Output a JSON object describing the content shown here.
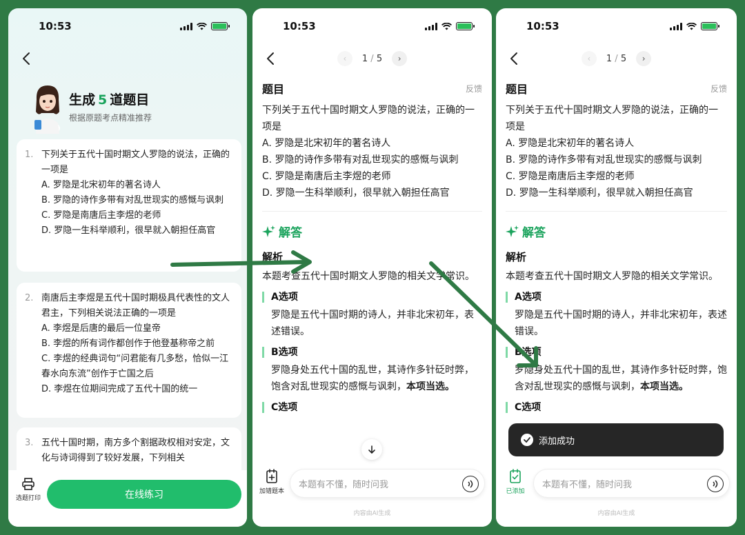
{
  "status": {
    "time": "10:53"
  },
  "screen1": {
    "title_prefix": "生成",
    "title_count": "5",
    "title_suffix": "道题目",
    "subtitle": "根据原题考点精准推荐",
    "questions": [
      {
        "num": "1.",
        "lines": [
          "下列关于五代十国时期文人罗隐的说法，正确的一项是",
          "A. 罗隐是北宋初年的著名诗人",
          "B. 罗隐的诗作多带有对乱世现实的感慨与讽刺",
          "C. 罗隐是南唐后主李煜的老师",
          "D. 罗隐一生科举顺利，很早就入朝担任高官"
        ]
      },
      {
        "num": "2.",
        "lines": [
          "南唐后主李煜是五代十国时期极具代表性的文人君主，下列相关说法正确的一项是",
          "A. 李煜是后唐的最后一位皇帝",
          "B. 李煜的所有词作都创作于他登基称帝之前",
          "C. 李煜的经典词句“问君能有几多愁，恰似一江春水向东流”创作于亡国之后",
          "D. 李煜在位期间完成了五代十国的统一"
        ]
      },
      {
        "num": "3.",
        "lines": [
          "五代十国时期，南方多个割据政权相对安定，文化与诗词得到了较好发展，下列相关"
        ]
      }
    ],
    "print_label": "选题打印",
    "practice_label": "在线练习"
  },
  "pager": {
    "page": "1",
    "sep": "/",
    "total": "5"
  },
  "detail": {
    "section_title": "题目",
    "feedback": "反馈",
    "question": "下列关于五代十国时期文人罗隐的说法，正确的一项是",
    "options": [
      "A. 罗隐是北宋初年的著名诗人",
      "B. 罗隐的诗作多带有对乱世现实的感慨与讽刺",
      "C. 罗隐是南唐后主李煜的老师",
      "D. 罗隐一生科举顺利，很早就入朝担任高官"
    ],
    "answer_label": "解答",
    "analysis_label": "解析",
    "analysis_intro": "本题考查五代十国时期文人罗隐的相关文学常识。",
    "opt_a_title": "A选项",
    "opt_a_text": "罗隐是五代十国时期的诗人，并非北宋初年，表述错误。",
    "opt_b_title": "B选项",
    "opt_b_text": "罗隐身处五代十国的乱世，其诗作多针砭时弊，饱含对乱世现实的感慨与讽刺，",
    "opt_b_bold": "本项当选。",
    "opt_c_title": "C选项",
    "ask_placeholder": "本题有不懂，随时问我",
    "ai_note": "内容由AI生成"
  },
  "screen2": {
    "add_label": "加错题本"
  },
  "screen3": {
    "added_label": "已添加",
    "toast": "添加成功"
  },
  "colors": {
    "accent": "#21bd6c",
    "frame": "#2f7a45"
  }
}
